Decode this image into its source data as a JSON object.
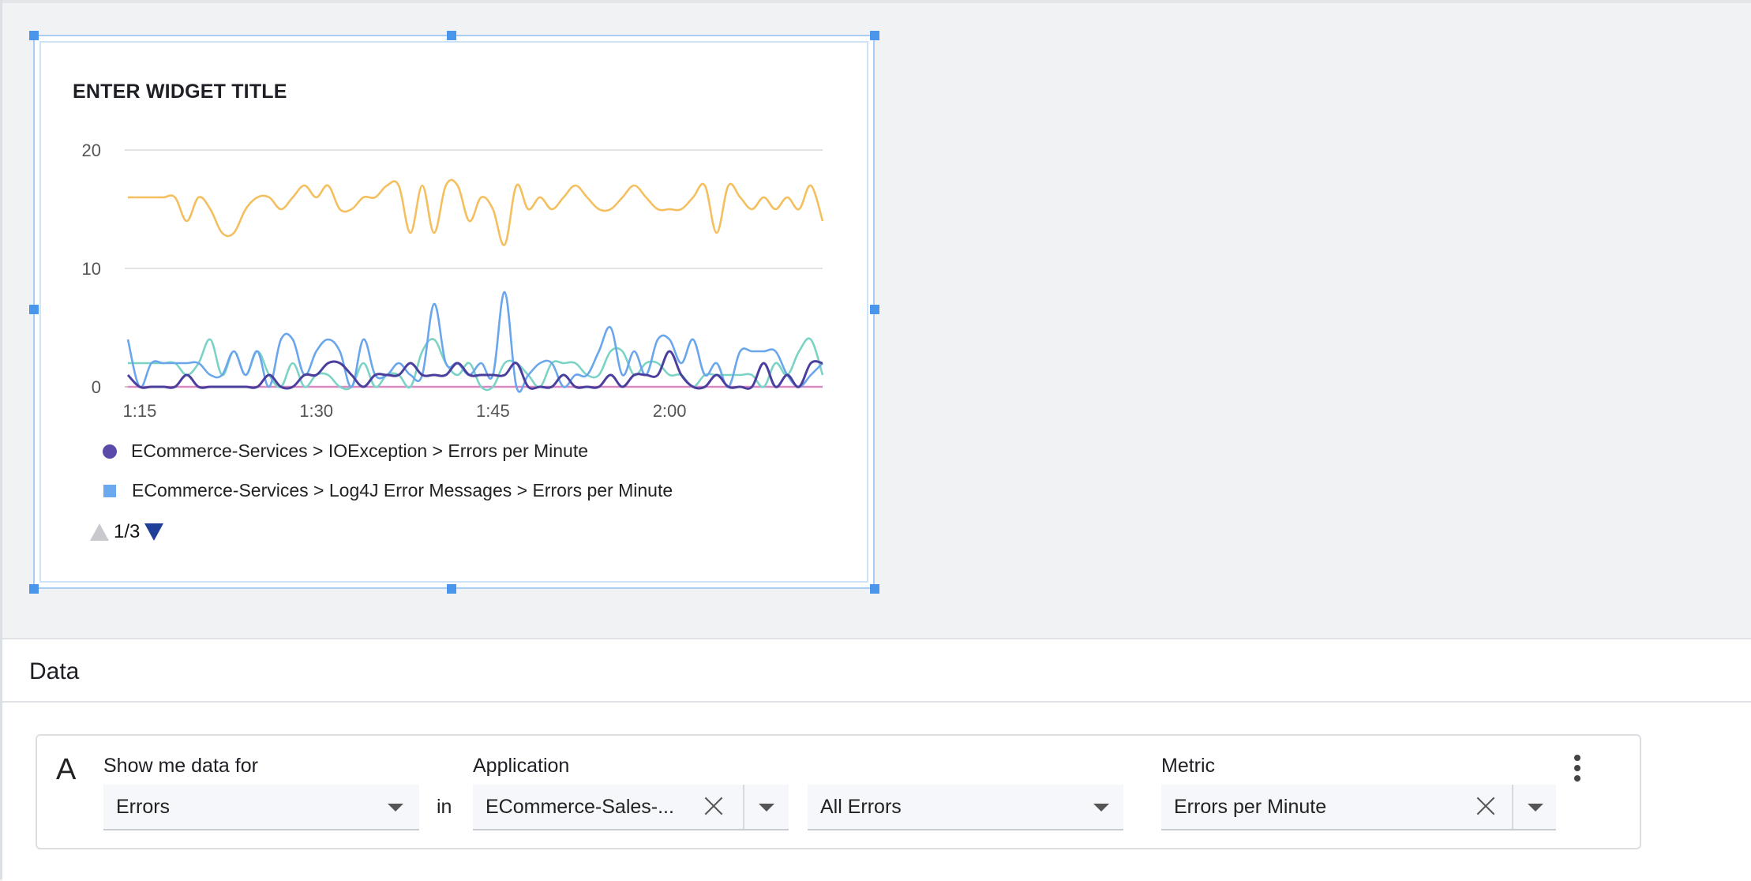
{
  "widget": {
    "title": "ENTER WIDGET TITLE",
    "legend": [
      {
        "label": "ECommerce-Services > IOException > Errors per Minute",
        "marker": "circle",
        "color": "#5b4aa8"
      },
      {
        "label": "ECommerce-Services > Log4J Error Messages > Errors per Minute",
        "marker": "square",
        "color": "#6ba8ee"
      }
    ],
    "pager": {
      "text": "1/3",
      "prev_icon": "triangle-up-icon",
      "next_icon": "triangle-down-icon"
    }
  },
  "chart_data": {
    "type": "line",
    "title": "ENTER WIDGET TITLE",
    "xlabel": "",
    "ylabel": "",
    "ylim": [
      0,
      20
    ],
    "yticks": [
      "0",
      "10",
      "20"
    ],
    "xticks": [
      "1:15",
      "1:30",
      "1:45",
      "2:00"
    ],
    "x_minutes": [
      0,
      1,
      2,
      3,
      4,
      5,
      6,
      7,
      8,
      9,
      10,
      11,
      12,
      13,
      14,
      15,
      16,
      17,
      18,
      19,
      20,
      21,
      22,
      23,
      24,
      25,
      26,
      27,
      28,
      29,
      30,
      31,
      32,
      33,
      34,
      35,
      36,
      37,
      38,
      39,
      40,
      41,
      42,
      43,
      44,
      45,
      46,
      47,
      48,
      49,
      50,
      51,
      52,
      53,
      54,
      55,
      56,
      57,
      58,
      59
    ],
    "x_start_label": "1:14",
    "grid": true,
    "legend_position": "bottom",
    "series": [
      {
        "name": "ECommerce-Services > IOException > Errors per Minute",
        "color": "#4b3f9e",
        "values": [
          1,
          0,
          0,
          0,
          0,
          1,
          0,
          0,
          0,
          0,
          0,
          0,
          1,
          0,
          0,
          1,
          1,
          2,
          2,
          1,
          0,
          1,
          1,
          1,
          2,
          1,
          1,
          1,
          2,
          1,
          1,
          1,
          1,
          2,
          0,
          0,
          0,
          1,
          0,
          0,
          0,
          1,
          0,
          1,
          1,
          1,
          3,
          1,
          0,
          0,
          1,
          0,
          0,
          0,
          2,
          0,
          1,
          0,
          2,
          2
        ]
      },
      {
        "name": "ECommerce-Services > Log4J Error Messages > Errors per Minute",
        "color": "#6aa6ec",
        "values": [
          4,
          0,
          2,
          2,
          2,
          2,
          2,
          1,
          1,
          3,
          1,
          3,
          0,
          4,
          4,
          1,
          3,
          4,
          3,
          0,
          4,
          1,
          1,
          2,
          1,
          1,
          7,
          2,
          2,
          1,
          2,
          1,
          8,
          0,
          1,
          2,
          2,
          0,
          1,
          1,
          3,
          5,
          1,
          3,
          1,
          4,
          4,
          2,
          4,
          1,
          2,
          0,
          3,
          3,
          3,
          3,
          1,
          0,
          1,
          2
        ]
      },
      {
        "name": "",
        "color": "#7bd3c5",
        "values": [
          2,
          2,
          2,
          2,
          2,
          1,
          2,
          4,
          1,
          3,
          1,
          3,
          1,
          0,
          2,
          0,
          1,
          1,
          0,
          0,
          2,
          0,
          1,
          1,
          0,
          3,
          4,
          2,
          1,
          2,
          0,
          0,
          2,
          2,
          1,
          0,
          2,
          2,
          2,
          1,
          1,
          3,
          3,
          1,
          2,
          2,
          1,
          1,
          0,
          1,
          1,
          1,
          1,
          1,
          0,
          2,
          1,
          3,
          4,
          1
        ]
      },
      {
        "name": "",
        "color": "#f4bf5e",
        "values": [
          16,
          16,
          16,
          16,
          16,
          14,
          16,
          15,
          13,
          13,
          15,
          16,
          16,
          15,
          16,
          17,
          16,
          17,
          15,
          15,
          16,
          16,
          17,
          17,
          13,
          17,
          13,
          17,
          17,
          14,
          16,
          15,
          12,
          17,
          15,
          16,
          15,
          16,
          17,
          16,
          15,
          15,
          16,
          17,
          16,
          15,
          15,
          15,
          16,
          17,
          13,
          17,
          16,
          15,
          16,
          15,
          16,
          15,
          17,
          14
        ]
      },
      {
        "name": "",
        "color": "#d98ac2",
        "values": [
          0,
          0,
          0,
          0,
          0,
          0,
          0,
          0,
          0,
          0,
          0,
          0,
          0,
          0,
          0,
          0,
          0,
          0,
          0,
          0,
          0,
          0,
          0,
          0,
          0,
          0,
          0,
          0,
          0,
          0,
          0,
          0,
          0,
          0,
          0,
          0,
          0,
          0,
          0,
          0,
          0,
          0,
          0,
          0,
          0,
          0,
          0,
          0,
          0,
          0,
          0,
          0,
          0,
          0,
          0,
          0,
          0,
          0,
          0,
          0
        ]
      }
    ]
  },
  "data_panel": {
    "title": "Data",
    "query": {
      "letter": "A",
      "show_me_label": "Show me data for",
      "show_me_value": "Errors",
      "in_text": "in",
      "application_label": "Application",
      "application_value": "ECommerce-Sales-...",
      "errors_value": "All Errors",
      "metric_label": "Metric",
      "metric_value": "Errors per Minute"
    }
  }
}
